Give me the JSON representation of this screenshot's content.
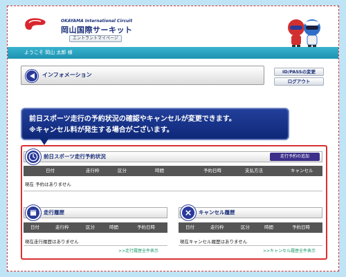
{
  "header": {
    "brand_en": "OKAYAMA International Circuit",
    "brand_jp": "岡山国際サーキット",
    "mypage_label": "エントラントマイページ"
  },
  "welcome": {
    "text": "ようこそ 岡山 太郎 様"
  },
  "info": {
    "label": "インフォメーション"
  },
  "side_buttons": {
    "change_id": "ID/PASSの変更",
    "logout": "ログアウト"
  },
  "notice": {
    "line1": "前日スポーツ走行の予約状況の確認やキャンセルが変更できます。",
    "line2": "※キャンセル料が発生する場合がございます。"
  },
  "reservations": {
    "title": "前日スポーツ走行予約状況",
    "add_button": "走行予約の追加",
    "columns": [
      "日付",
      "走行枠",
      "区分",
      "時間",
      "予約日時",
      "支払方法",
      "キャンセル"
    ],
    "empty": "現在 予約はありません"
  },
  "history": {
    "title": "走行履歴",
    "columns": [
      "日付",
      "走行枠",
      "区分",
      "時間",
      "予約日時"
    ],
    "empty": "現在走行履歴はありません",
    "more": ">>走行履歴全件表示"
  },
  "cancel_history": {
    "title": "キャンセル履歴",
    "columns": [
      "日付",
      "走行枠",
      "区分",
      "時間",
      "予約日時"
    ],
    "empty": "現在キャンセル履歴はありません",
    "more": ">>キャンセル履歴全件表示"
  },
  "colors": {
    "navy": "#1a2f7a",
    "cyan_bar": "#2aa3c2",
    "red_border": "#d83030",
    "table_header": "#555555"
  }
}
